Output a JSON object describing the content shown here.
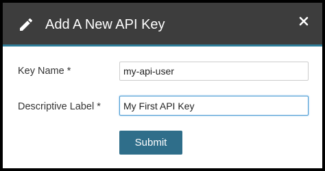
{
  "dialog": {
    "title": "Add A New API Key",
    "header_icon": "pencil-icon",
    "close_icon": "close-icon"
  },
  "form": {
    "key_name": {
      "label": "Key Name *",
      "value": "my-api-user"
    },
    "descriptive_label": {
      "label": "Descriptive Label *",
      "value": "My First API Key"
    },
    "submit_label": "Submit"
  },
  "colors": {
    "header_bg": "#3d3d3d",
    "header_accent": "#2e7d99",
    "button_bg": "#2f6e8a",
    "focus_border": "#4b9bd3"
  }
}
